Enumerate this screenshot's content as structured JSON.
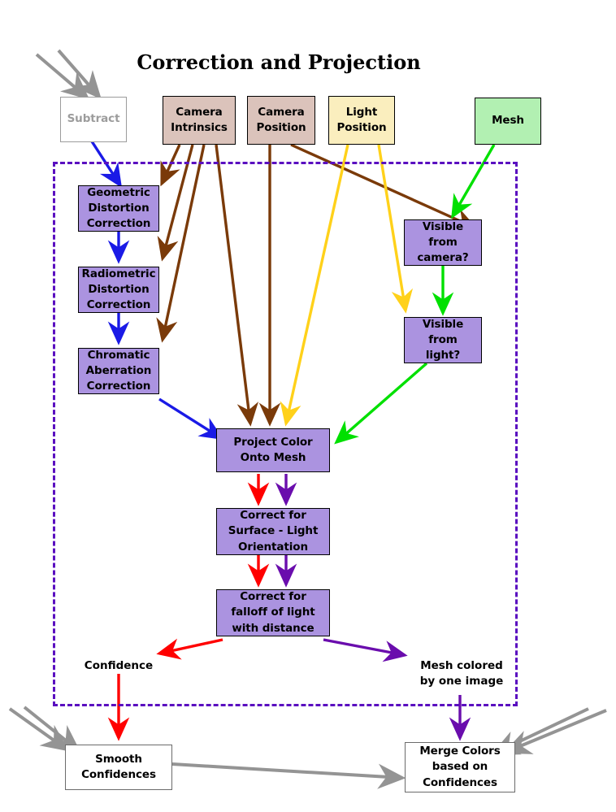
{
  "title": "Correction and Projection",
  "colors": {
    "process_box": "#ab93e0",
    "camera_input_box": "#dbc3bb",
    "light_input_box": "#faeebe",
    "mesh_box": "#b2f0b2",
    "disabled_box": "#9c9c9c",
    "region_border": "#5a0fc0",
    "blue_arrow": "#1a1ae6",
    "brown_arrow": "#7a3a09",
    "yellow_arrow": "#ffd11a",
    "green_arrow": "#00e000",
    "red_arrow": "#ff0000",
    "purple_arrow": "#6a0dad",
    "gray_arrow": "#949494"
  },
  "nodes": {
    "subtract": "Subtract",
    "camera_intrinsics": "Camera\nIntrinsics",
    "camera_position": "Camera\nPosition",
    "light_position": "Light\nPosition",
    "mesh": "Mesh",
    "geometric_distortion_correction": "Geometric\nDistortion\nCorrection",
    "radiometric_distortion_correction": "Radiometric\nDistortion\nCorrection",
    "chromatic_aberration_correction": "Chromatic\nAberration\nCorrection",
    "visible_from_camera": "Visible\nfrom\ncamera?",
    "visible_from_light": "Visible\nfrom\nlight?",
    "project_color_onto_mesh": "Project Color\nOnto Mesh",
    "correct_surface_light_orientation": "Correct for\nSurface - Light\nOrientation",
    "correct_falloff_of_light": "Correct for\nfalloff of light\nwith distance",
    "smooth_confidences": "Smooth\nConfidences",
    "merge_colors_based_on_confidences": "Merge Colors\nbased on\nConfidences"
  },
  "labels": {
    "confidence": "Confidence",
    "mesh_colored_by_one_image": "Mesh colored\nby one image"
  }
}
